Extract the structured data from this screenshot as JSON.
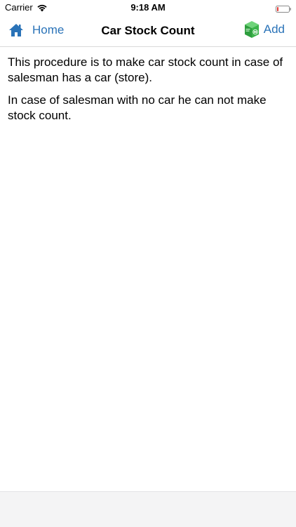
{
  "status_bar": {
    "carrier": "Carrier",
    "time": "9:18 AM",
    "icons": [
      "wifi-icon",
      "battery-icon"
    ]
  },
  "nav": {
    "back_label": "Home",
    "back_icon": "home-icon",
    "title": "Car Stock Count",
    "action_label": "Add",
    "action_icon": "add-box-icon"
  },
  "content": {
    "paragraphs": [
      "This procedure is to make car stock count in case of salesman has a car (store).",
      "In case of salesman with no car he can not make stock count."
    ]
  },
  "colors": {
    "accent": "#2a73b8",
    "battery_low": "#e53935",
    "add_icon_green": "#3cb44b"
  }
}
